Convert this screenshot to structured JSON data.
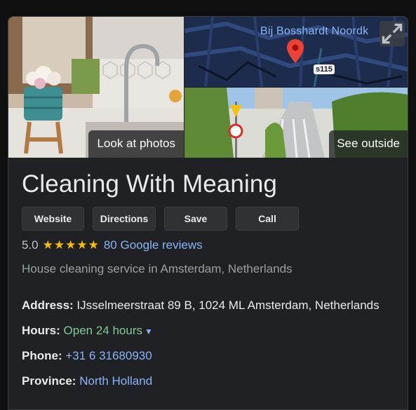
{
  "photos": {
    "main_label": "Look at photos",
    "street_label": "See outside",
    "map_place_label": "Bij Bosshardt Noordk",
    "route_badge": "s115"
  },
  "business": {
    "name": "Cleaning With Meaning",
    "rating": "5.0",
    "stars": "★★★★★",
    "reviews_link": "80 Google reviews",
    "category": "House cleaning service in Amsterdam, Netherlands"
  },
  "actions": {
    "website": "Website",
    "directions": "Directions",
    "save": "Save",
    "call": "Call"
  },
  "details": {
    "address_label": "Address:",
    "address_value": "IJsselmeerstraat 89 B, 1024 ML Amsterdam, Netherlands",
    "hours_label": "Hours:",
    "hours_value": "Open 24 hours",
    "phone_label": "Phone:",
    "phone_value": "+31 6 31680930",
    "province_label": "Province:",
    "province_value": "North Holland"
  },
  "colors": {
    "background": "#202124",
    "link": "#8ab4f8",
    "open": "#81c995",
    "star": "#fbbc04"
  },
  "icons": [
    "expand-icon",
    "map-pin-icon",
    "dropdown-caret-icon"
  ]
}
